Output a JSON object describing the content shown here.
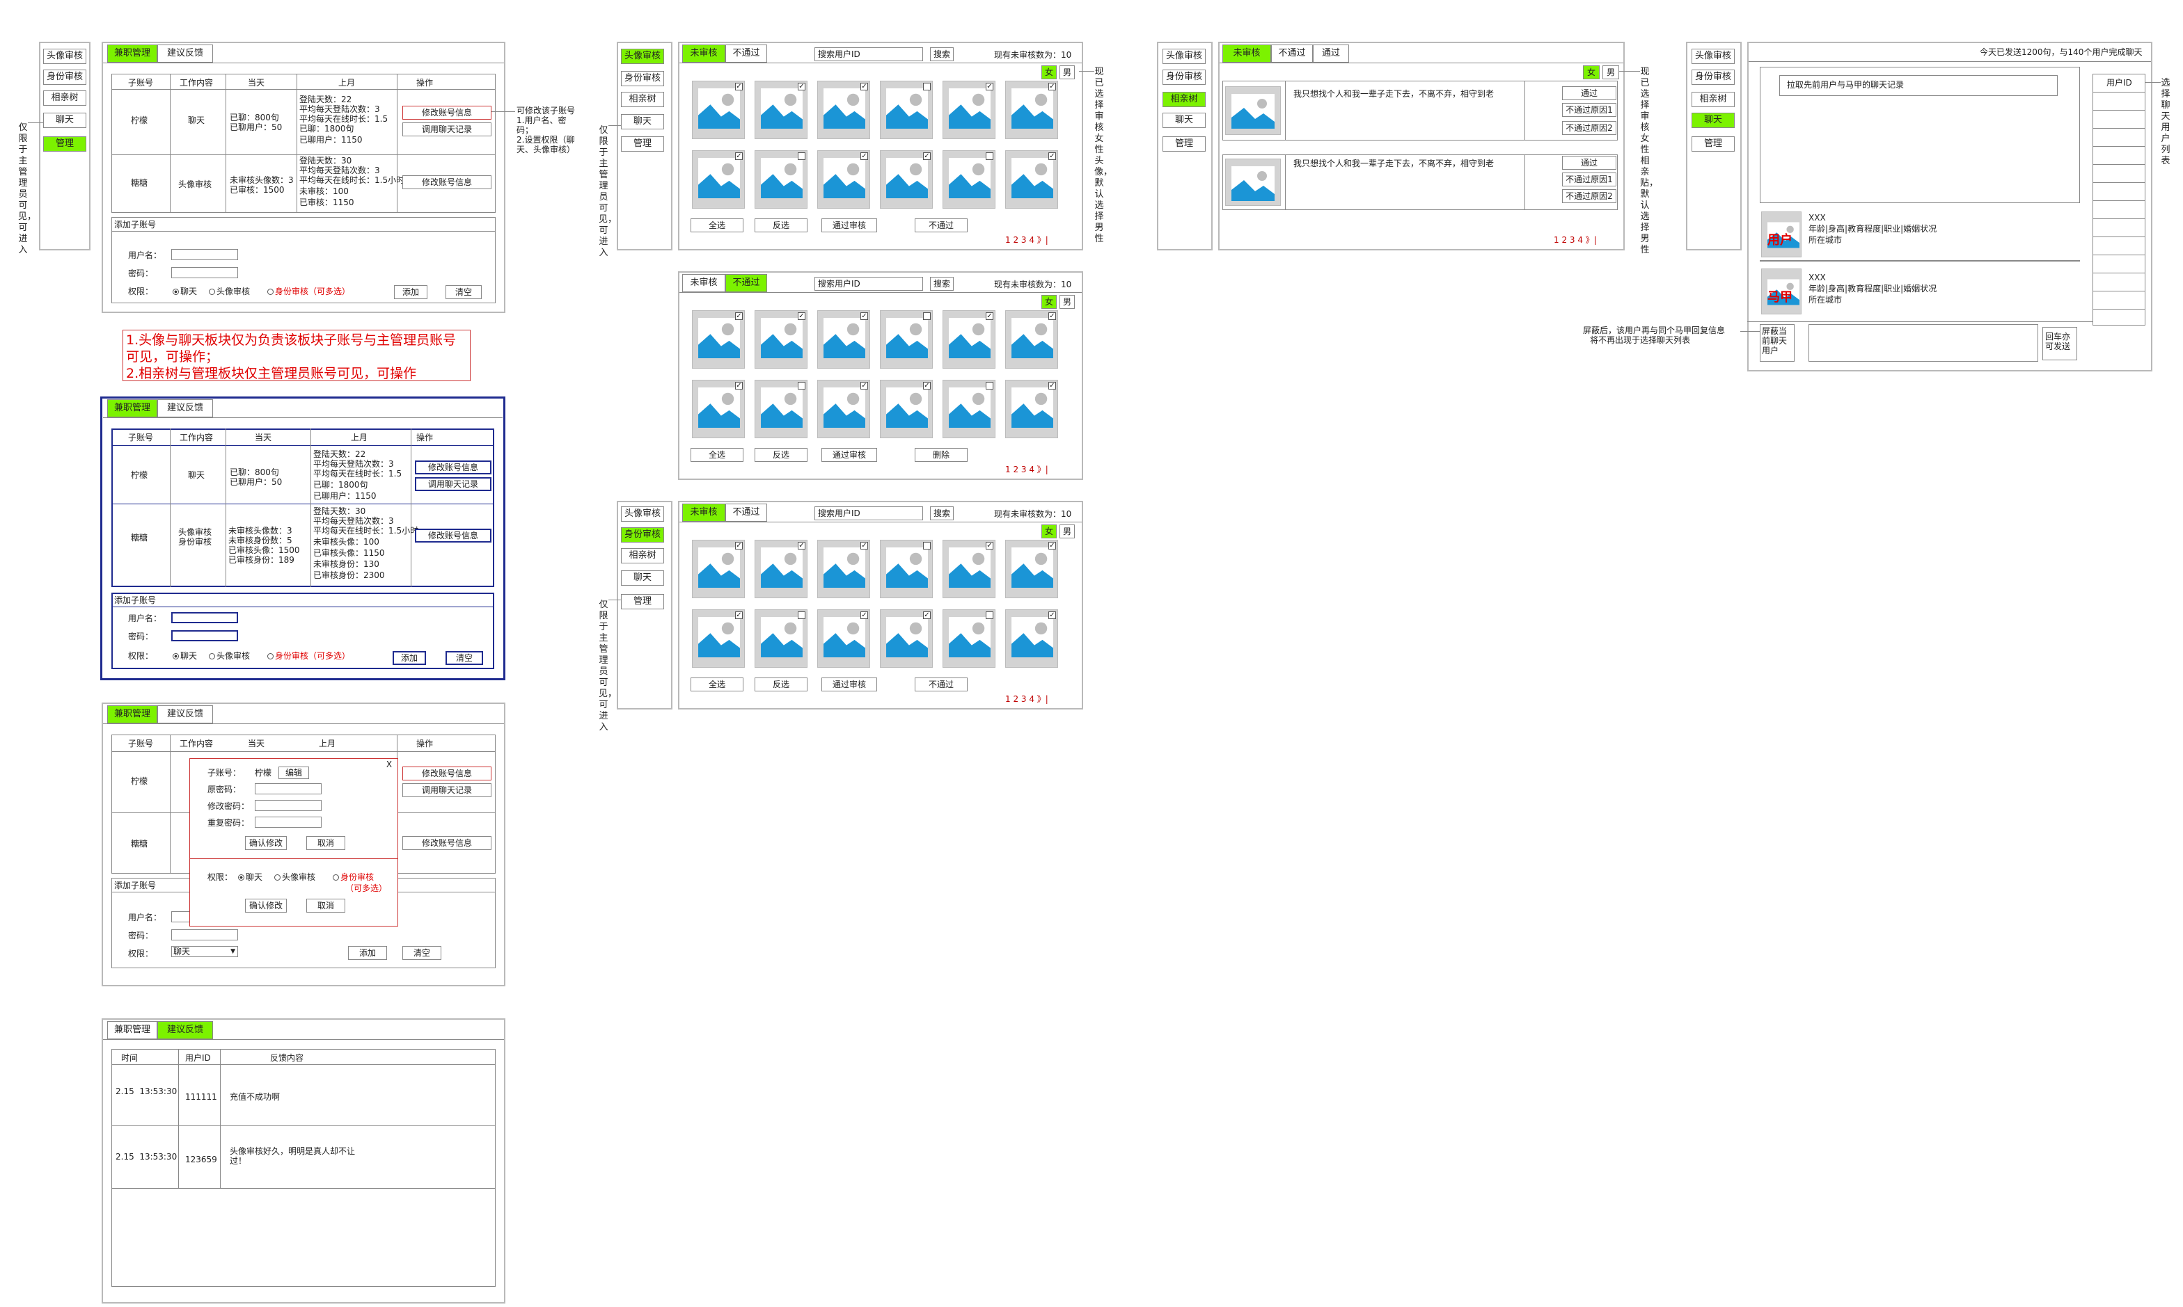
{
  "nav": {
    "avatar_review": "头像审核",
    "id_review": "身份审核",
    "matchmaker_tree": "相亲树",
    "chat": "聊天",
    "manage": "管理"
  },
  "annotations": {
    "admin_only": "仅限于主管理员可见，可进入",
    "modify_sub_account": [
      "可修改该子账号",
      "1.用户名、密",
      "码；",
      "2.设置权限（聊",
      "天、头像审核）"
    ],
    "notes": [
      "1.头像与聊天板块仅为负责该板块子账号与主管理员账号可见，可操作；",
      "2.相亲树与管理板块仅主管理员账号可见，可操作"
    ],
    "already_selected_female_avatar": "现已选择审核女性头像，默认选择男性",
    "already_selected_female_post": "现已选择审核女性相亲贴，默认选择男性",
    "choose_chat_user": "选择聊天用户列表",
    "block_note": [
      "屏蔽后，该用户再与同个马甲回复信息",
      "将不再出现于选择聊天列表"
    ]
  },
  "admin": {
    "tab_part_time": "兼职管理",
    "tab_feedback": "建议反馈",
    "col_sub_account": "子账号",
    "col_work": "工作内容",
    "col_today": "当天",
    "col_last_month": "上月",
    "col_operation": "操作",
    "row1": {
      "account": "柠檬",
      "work": "聊天",
      "today": [
        "已聊：800句",
        "已聊用户：50"
      ],
      "month": [
        "登陆天数：22",
        "平均每天登陆次数：3",
        "平均每天在线时长：1.5",
        "已聊：1800句",
        "已聊用户：1150"
      ]
    },
    "row2": {
      "account": "糖糖",
      "work": "头像审核",
      "today": [
        "未审核头像数：3",
        "已审核：1500"
      ],
      "month": [
        "登陆天数：30",
        "平均每天登陆次数：3",
        "平均每天在线时长：1.5小时",
        "未审核：100",
        "已审核：1150"
      ]
    },
    "row2b": {
      "work": [
        "头像审核",
        "身份审核"
      ],
      "today": [
        "未审核头像数：3",
        "未审核身份数：5",
        "已审核头像：1500",
        "已审核身份：189"
      ],
      "month": [
        "登陆天数：30",
        "平均每天登陆次数：3",
        "平均每天在线时长：1.5小时",
        "未审核头像：100",
        "已审核头像：1150",
        "未审核身份：130",
        "已审核身份：2300"
      ]
    },
    "row1b_month": [
      "登陆天数：22",
      "平均每天登陆次数：3",
      "平均每天在线时长：1.5",
      "已聊：1800句",
      "已聊用户：1150"
    ],
    "btn_modify": "修改账号信息",
    "btn_chat_log": "调用聊天记录",
    "add_sub_account": "添加子账号",
    "username": "用户名：",
    "password": "密码：",
    "permission": "权限：",
    "perm_chat": "聊天",
    "perm_avatar": "头像审核",
    "perm_id": "身份审核",
    "multi": "（可多选）",
    "btn_add": "添加",
    "btn_clear": "清空",
    "select_value": "聊天"
  },
  "modal": {
    "close": "X",
    "sub_account_label": "子账号：",
    "sub_account_value": "柠檬",
    "edit": "编辑",
    "old_pwd": "原密码：",
    "new_pwd": "修改密码：",
    "repeat_pwd": "重复密码：",
    "confirm": "确认修改",
    "cancel": "取消",
    "multi": "（可多选）"
  },
  "feedback": {
    "col_time": "时间",
    "col_uid": "用户ID",
    "col_content": "反馈内容",
    "rows": [
      {
        "time": "2.15  13:53:30",
        "uid": "111111",
        "content": "充值不成功啊"
      },
      {
        "time": "2.15  13:53:30",
        "uid": "123659",
        "content": "头像审核好久，明明是真人却不让过！"
      }
    ]
  },
  "review": {
    "tab_pending": "未审核",
    "tab_rejected": "不通过",
    "tab_passed": "通过",
    "search_placeholder": "搜索用户ID",
    "search_btn": "搜索",
    "pending_count": "现有未审核数为：10",
    "female": "女",
    "male": "男",
    "select_all": "全选",
    "invert": "反选",
    "pass": "通过审核",
    "reject": "不通过",
    "delete": "删除",
    "pager": "1 2 3 4 》|"
  },
  "posts": {
    "text": "我只想找个人和我一辈子走下去，不离不弃，相守到老",
    "pass": "通过",
    "reason1": "不通过原因1",
    "reason2": "不通过原因2"
  },
  "chat": {
    "header": "今天已发送1200句，与140个用户完成聊天",
    "pull_record": "拉取先前用户与马甲的聊天记录",
    "user_id": "用户ID",
    "user_label": "用户",
    "vest_label": "马甲",
    "name": "XXX",
    "info": "年龄|身高|教育程度|职业|婚姻状况",
    "city": "所在城市",
    "block_btn": "屏蔽当前聊天用户",
    "send_btn": "回车亦可发送"
  }
}
